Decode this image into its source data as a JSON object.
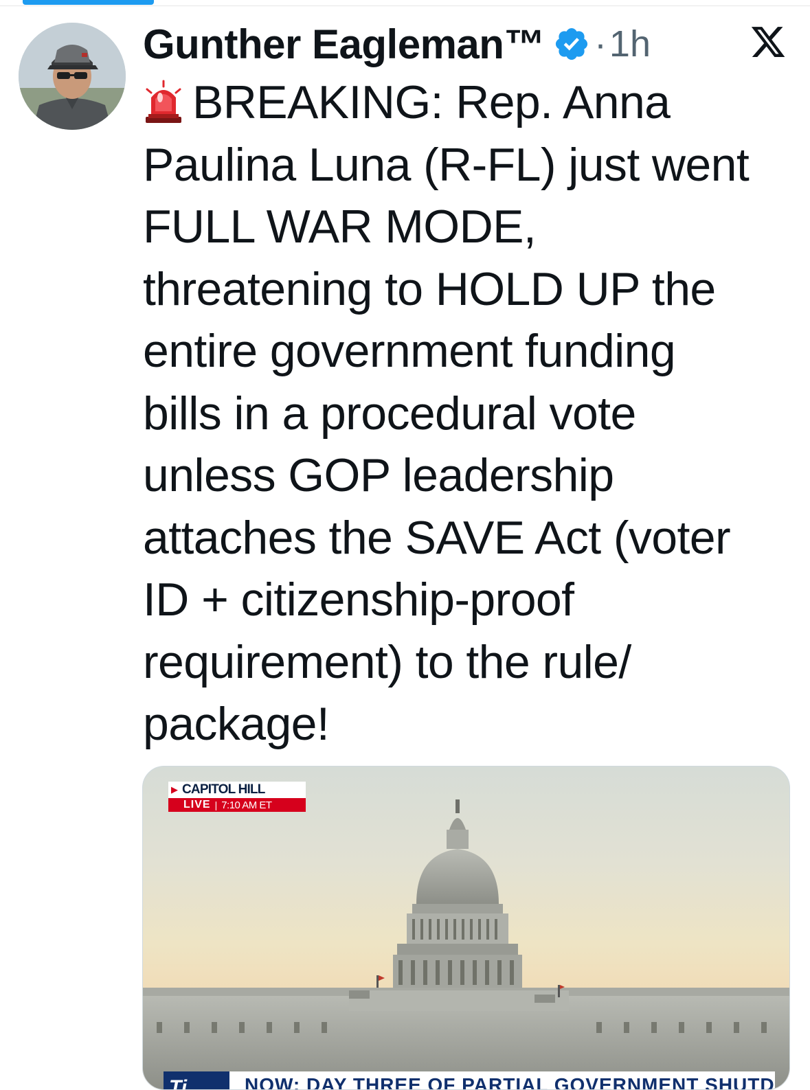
{
  "tweet": {
    "author": {
      "display_name": "Gunther Eagleman™",
      "verified": true,
      "avatar_icon": "avatar-photo"
    },
    "separator": "·",
    "timestamp": "1h",
    "platform_icon": "x-logo-icon",
    "text_lines": [
      "BREAKING: Rep. Anna",
      "Paulina Luna (R-FL) just went",
      "FULL WAR MODE,",
      "threatening to HOLD UP the",
      "entire government funding",
      "bills in a procedural vote",
      "unless GOP leadership",
      "attaches the SAVE Act (voter",
      "ID + citizenship-proof",
      "requirement) to the rule/",
      "package!"
    ],
    "leading_emoji": "police-siren-icon",
    "media": {
      "type": "video-still",
      "live_bug": {
        "location": "CAPITOL HILL",
        "live_label": "LIVE",
        "separator": "|",
        "time": "7:10 AM ET"
      },
      "lower_third": {
        "logo_text": "Ti",
        "headline": "NOW: DAY THREE OF PARTIAL GOVERNMENT SHUTDOWN"
      }
    }
  },
  "colors": {
    "accent": "#1d9bf0",
    "text_primary": "#0f1419",
    "text_secondary": "#536471",
    "live_red": "#d6001c",
    "news_blue": "#10306d"
  }
}
